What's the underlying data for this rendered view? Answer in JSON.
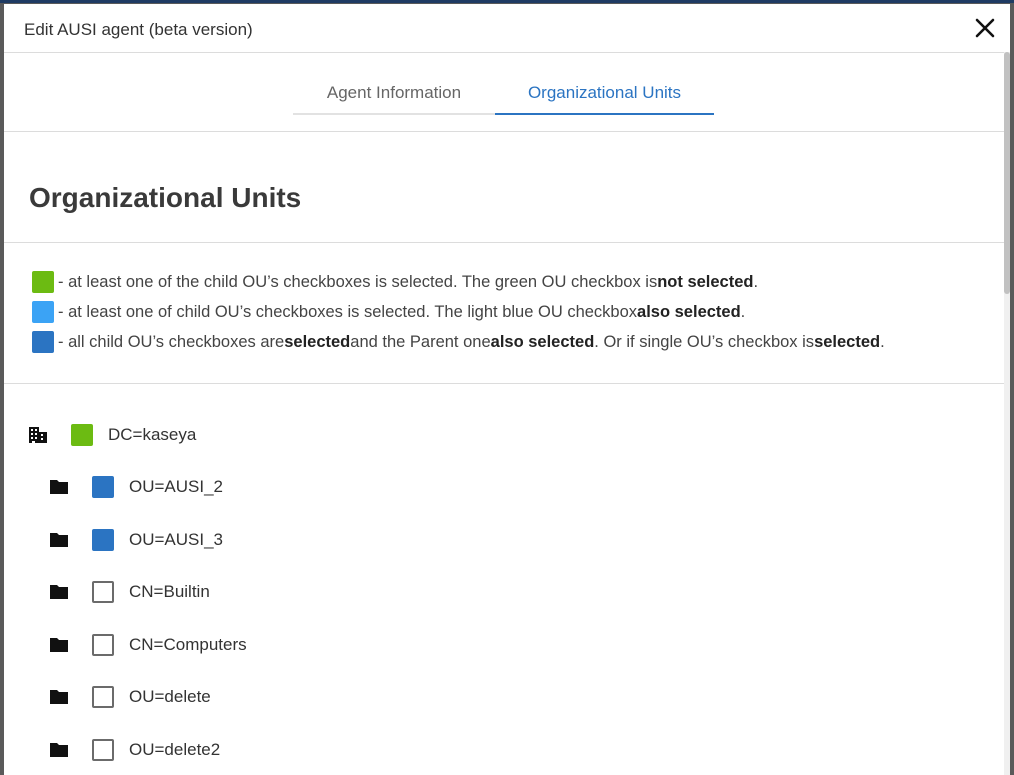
{
  "dialog": {
    "title": "Edit AUSI agent (beta version)",
    "close_icon": "close-icon"
  },
  "tabs": [
    {
      "label": "Agent Information",
      "active": false
    },
    {
      "label": "Organizational Units",
      "active": true
    }
  ],
  "section": {
    "title": "Organizational Units"
  },
  "legend": {
    "colors": {
      "green": "#6cbb12",
      "light_blue": "#3ba3f5",
      "dark_blue": "#2b74c2"
    },
    "rows": [
      {
        "prefix": "- at least one of the child OU’s checkboxes is selected. The green OU checkbox is ",
        "b1": "not selected",
        "suffix": "."
      },
      {
        "prefix": "- at least one of child OU’s checkboxes is selected. The light blue OU checkbox ",
        "b1": "also selected",
        "suffix": "."
      },
      {
        "prefix": "- all child OU’s checkboxes are ",
        "b1": "selected",
        "mid1": " and the Parent one ",
        "b2": "also selected",
        "mid2": ". Or if single OU’s checkbox is ",
        "b3": "selected",
        "suffix": "."
      }
    ]
  },
  "tree": [
    {
      "label": "DC=kaseya",
      "icon": "building-icon",
      "state": "partial-green"
    },
    {
      "label": "OU=AUSI_2",
      "icon": "folder-icon",
      "state": "selected"
    },
    {
      "label": "OU=AUSI_3",
      "icon": "folder-icon",
      "state": "selected"
    },
    {
      "label": "CN=Builtin",
      "icon": "folder-icon",
      "state": "unchecked"
    },
    {
      "label": "CN=Computers",
      "icon": "folder-icon",
      "state": "unchecked"
    },
    {
      "label": "OU=delete",
      "icon": "folder-icon",
      "state": "unchecked"
    },
    {
      "label": "OU=delete2",
      "icon": "folder-icon",
      "state": "unchecked"
    }
  ]
}
